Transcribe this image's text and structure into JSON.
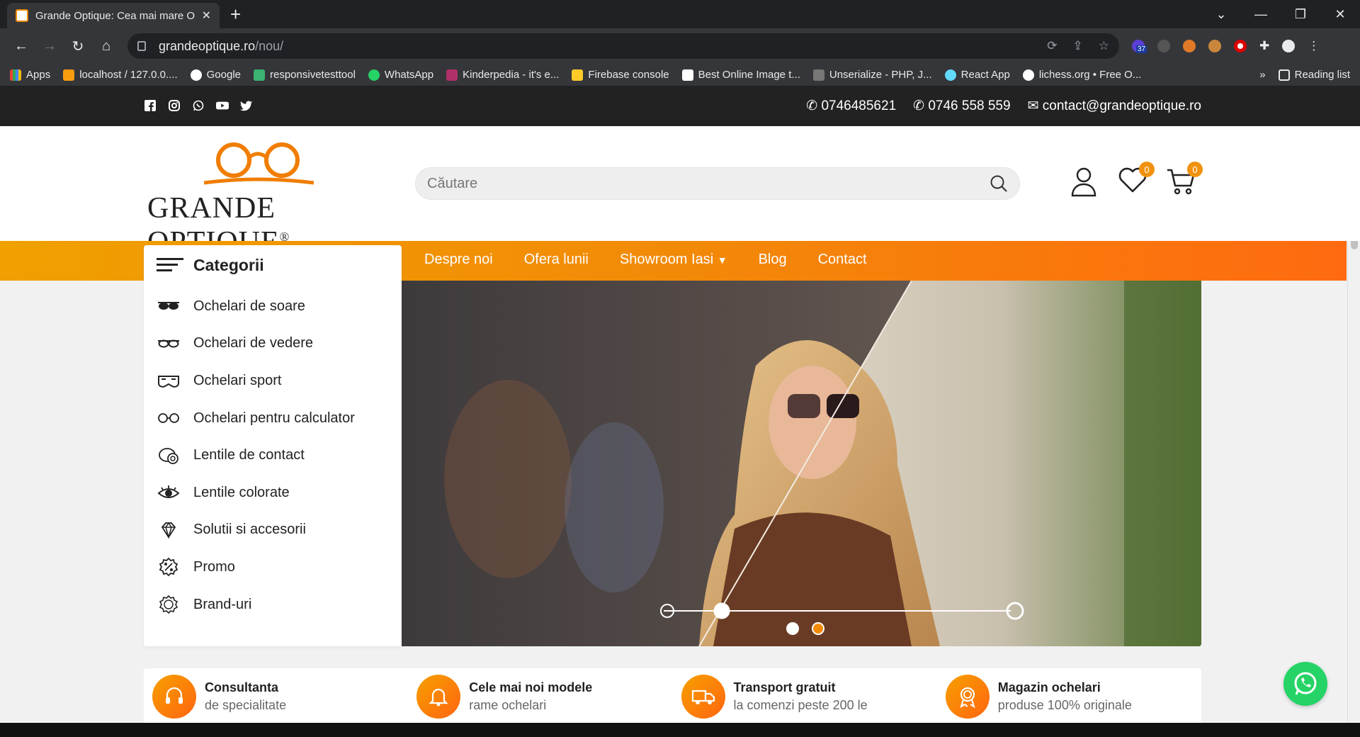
{
  "browser": {
    "tab_title": "Grande Optique: Cea mai mare O",
    "url_domain": "grandeoptique.ro",
    "url_path": "/nou/",
    "bookmarks": [
      "Apps",
      "localhost / 127.0.0....",
      "Google",
      "responsivetesttool",
      "WhatsApp",
      "Kinderpedia - it's e...",
      "Firebase console",
      "Best Online Image t...",
      "Unserialize - PHP, J...",
      "React App",
      "lichess.org • Free O..."
    ],
    "bookmarks_more": "»",
    "reading_list": "Reading list",
    "ext_badge": "37"
  },
  "topbar": {
    "phone1": "0746485621",
    "phone2": "0746 558 559",
    "email": "contact@grandeoptique.ro",
    "social_icons": [
      "facebook-icon",
      "instagram-icon",
      "whatsapp-icon",
      "youtube-icon",
      "twitter-icon"
    ]
  },
  "header": {
    "brand": "GRANDE OPTIQUE",
    "registered": "®",
    "search_placeholder": "Căutare",
    "wishlist_count": "0",
    "cart_count": "0"
  },
  "nav": {
    "categories_label": "Categorii",
    "links": [
      "Despre noi",
      "Ofera lunii",
      "Showroom Iasi",
      "Blog",
      "Contact"
    ]
  },
  "categories": [
    {
      "label": "Ochelari de soare",
      "icon": "sunglasses-icon"
    },
    {
      "label": "Ochelari de vedere",
      "icon": "eyeglasses-icon"
    },
    {
      "label": "Ochelari sport",
      "icon": "sport-goggles-icon"
    },
    {
      "label": "Ochelari pentru calculator",
      "icon": "computer-glasses-icon"
    },
    {
      "label": "Lentile de contact",
      "icon": "contact-lens-icon"
    },
    {
      "label": "Lentile colorate",
      "icon": "eye-icon"
    },
    {
      "label": "Solutii si accesorii",
      "icon": "diamond-icon"
    },
    {
      "label": "Promo",
      "icon": "percent-badge-icon"
    },
    {
      "label": "Brand-uri",
      "icon": "brand-badge-icon"
    }
  ],
  "features": [
    {
      "title": "Consultanta",
      "subtitle": "de specialitate",
      "icon": "headset-icon"
    },
    {
      "title": "Cele mai noi modele",
      "subtitle": "rame ochelari",
      "icon": "bell-icon"
    },
    {
      "title": "Transport gratuit",
      "subtitle": "la comenzi peste 200 le",
      "icon": "truck-icon"
    },
    {
      "title": "Magazin ochelari",
      "subtitle": "produse 100% originale",
      "icon": "medal-icon"
    }
  ],
  "colors": {
    "accent": "#f28a08",
    "accent_end": "#ff6a10",
    "dark": "#222222",
    "whatsapp": "#25d366"
  }
}
